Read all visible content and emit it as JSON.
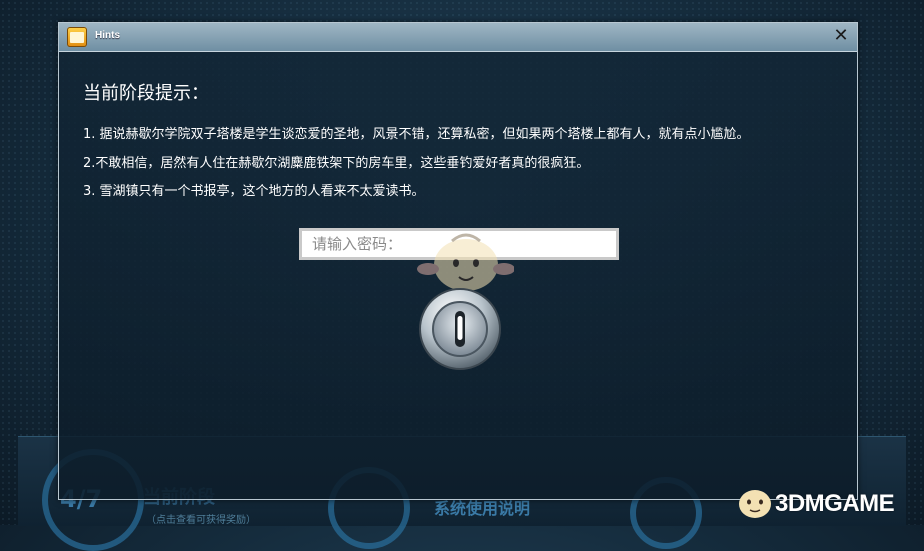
{
  "window": {
    "title": "Hints",
    "close_symbol": "✕"
  },
  "content": {
    "heading": "当前阶段提示：",
    "hints": [
      "1. 据说赫歇尔学院双子塔楼是学生谈恋爱的圣地，风景不错，还算私密，但如果两个塔楼上都有人，就有点小尴尬。",
      "2.不敢相信，居然有人住在赫歇尔湖麋鹿铁架下的房车里，这些垂钓爱好者真的很疯狂。",
      "3. 雪湖镇只有一个书报亭，这个地方的人看来不太爱读书。"
    ],
    "password_input": {
      "placeholder": "请输入密码：",
      "value": ""
    }
  },
  "background": {
    "progress": "4/7",
    "stage_label": "当前阶段",
    "stage_note": "（点击查看可获得奖励）",
    "manual_label": "系统使用说明"
  },
  "watermark": {
    "text": "3DMGAME"
  },
  "icons": [
    "hints-app-icon",
    "close-icon",
    "lock-icon",
    "mascot-icon"
  ],
  "colors": {
    "titlebar": "#8aa6b7",
    "dialog_bg": "#122636",
    "text": "#ffffff",
    "accent": "#2a6f9c"
  }
}
